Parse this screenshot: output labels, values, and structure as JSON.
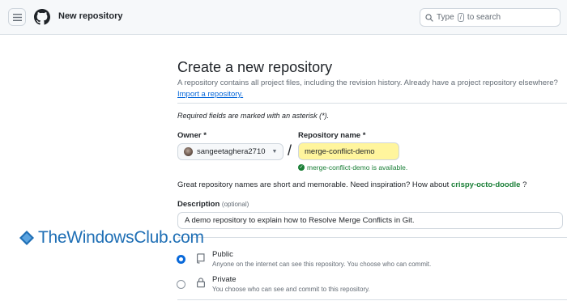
{
  "header": {
    "title": "New repository",
    "search_prefix": "Type",
    "search_key": "/",
    "search_suffix": "to search"
  },
  "form": {
    "title": "Create a new repository",
    "subtitle": "A repository contains all project files, including the revision history. Already have a project repository elsewhere?",
    "import_link": "Import a repository.",
    "required_note": "Required fields are marked with an asterisk (*).",
    "owner_label": "Owner *",
    "owner_value": "sangeetaghera2710",
    "slash": "/",
    "repo_label": "Repository name *",
    "repo_value": "merge-conflict-demo",
    "availability": "merge-conflict-demo is available.",
    "inspiration_text": "Great repository names are short and memorable. Need inspiration? How about",
    "suggestion": "crispy-octo-doodle",
    "inspiration_end": "?",
    "description_label": "Description",
    "description_optional": "(optional)",
    "description_value": "A demo repository to explain how to Resolve Merge Conflicts in Git."
  },
  "visibility": [
    {
      "title": "Public",
      "desc": "Anyone on the internet can see this repository. You choose who can commit.",
      "selected": true
    },
    {
      "title": "Private",
      "desc": "You choose who can see and commit to this repository.",
      "selected": false
    }
  ],
  "watermark": "TheWindowsClub.com",
  "colors": {
    "accent": "#0969da",
    "success": "#1a7f37",
    "highlight": "#fff59d",
    "watermark": "#1f6fb5"
  }
}
